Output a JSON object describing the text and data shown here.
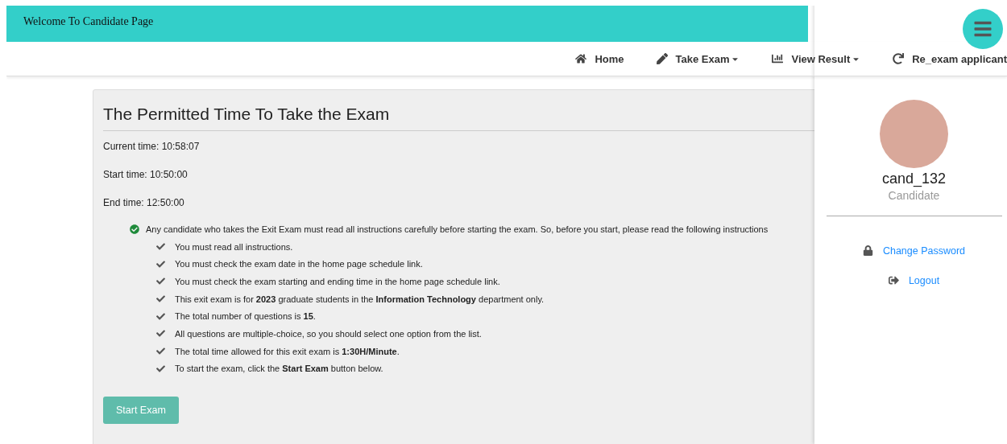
{
  "header": {
    "title": "Welcome To Candidate Page"
  },
  "nav": [
    {
      "label": "Home",
      "dropdown": false
    },
    {
      "label": "Take Exam",
      "dropdown": true
    },
    {
      "label": "View Result",
      "dropdown": true
    },
    {
      "label": "Re_exam applicant",
      "dropdown": false
    }
  ],
  "card": {
    "title": "The Permitted Time To Take the Exam",
    "times": [
      "Current time: 10:58:07",
      "Start time: 10:50:00",
      "End time: 12:50:00"
    ],
    "intro": "Any candidate who takes the Exit Exam must read all instructions carefully before starting the exam. So, before you start, please read the following instructions",
    "instructions": [
      "You must read all instructions.",
      "You must check the exam date in the home page schedule link.",
      "You must check the exam starting and ending time in the home page schedule link.",
      "This exit exam is for **2023** graduate students in the **Information Technology** department only.",
      "The total number of questions is **15**.",
      "All questions are multiple-choice, so you should select one option from the list.",
      "The total time allowed for this exit exam is **1:30H/Minute**.",
      "To start the exam, click the **Start Exam** button below."
    ],
    "button": "Start Exam"
  },
  "profile": {
    "username": "cand_132",
    "role": "Candidate",
    "links": [
      {
        "label": "Change Password"
      },
      {
        "label": "Logout"
      }
    ]
  }
}
